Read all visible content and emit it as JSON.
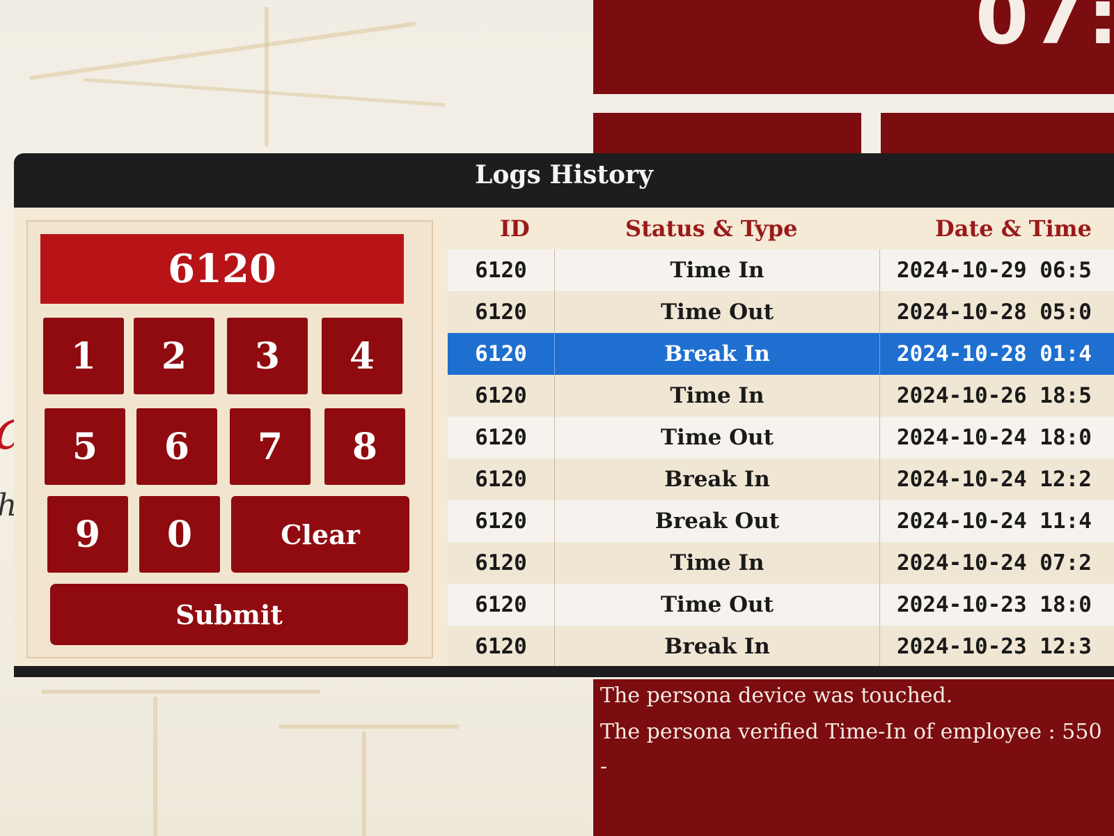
{
  "clock": {
    "partial_time": "07:"
  },
  "modal": {
    "title": "Logs History"
  },
  "keypad": {
    "display_value": "6120",
    "keys": [
      "1",
      "2",
      "3",
      "4",
      "5",
      "6",
      "7",
      "8",
      "9",
      "0"
    ],
    "clear_label": "Clear",
    "submit_label": "Submit"
  },
  "logs_table": {
    "headers": {
      "id": "ID",
      "status": "Status & Type",
      "datetime": "Date & Time"
    },
    "rows": [
      {
        "id": "6120",
        "status": "Time In",
        "datetime": "2024-10-29 06:5"
      },
      {
        "id": "6120",
        "status": "Time Out",
        "datetime": "2024-10-28 05:0"
      },
      {
        "id": "6120",
        "status": "Break In",
        "datetime": "2024-10-28 01:4"
      },
      {
        "id": "6120",
        "status": "Time In",
        "datetime": "2024-10-26 18:5"
      },
      {
        "id": "6120",
        "status": "Time Out",
        "datetime": "2024-10-24 18:0"
      },
      {
        "id": "6120",
        "status": "Break In",
        "datetime": "2024-10-24 12:2"
      },
      {
        "id": "6120",
        "status": "Break Out",
        "datetime": "2024-10-24 11:4"
      },
      {
        "id": "6120",
        "status": "Time In",
        "datetime": "2024-10-24 07:2"
      },
      {
        "id": "6120",
        "status": "Time Out",
        "datetime": "2024-10-23 18:0"
      },
      {
        "id": "6120",
        "status": "Break In",
        "datetime": "2024-10-23 12:3"
      }
    ],
    "selected_row": 2
  },
  "messages": {
    "line1": "The persona device was touched.",
    "line2": "The persona verified Time-In of employee : 550",
    "line3": "-"
  },
  "colors": {
    "brand_red": "#8f0b10",
    "display_red": "#b81418",
    "panel_red": "#7b0c10",
    "selection_blue": "#1e6fd0",
    "header_text": "#9a1a1a"
  }
}
